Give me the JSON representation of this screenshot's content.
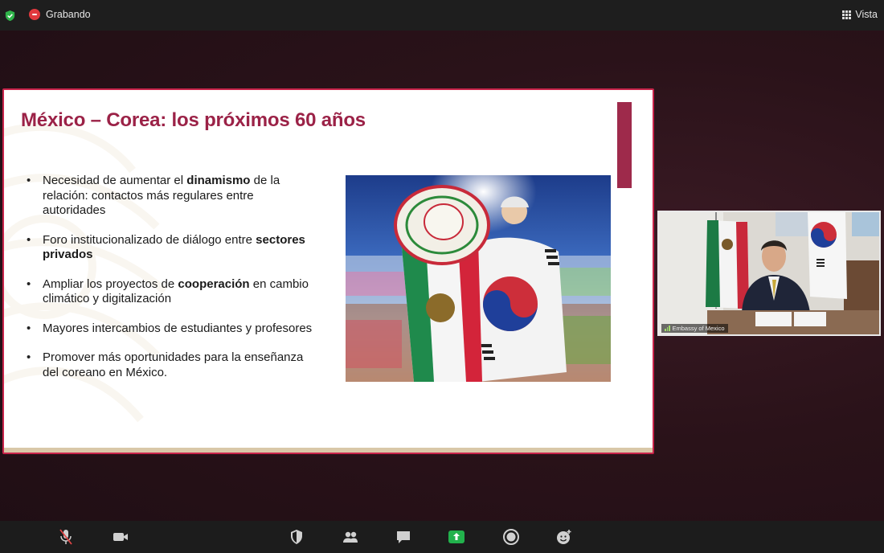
{
  "topbar": {
    "recording_label": "Grabando",
    "view_label": "Vista"
  },
  "slide": {
    "title": "México – Corea: los próximos 60 años",
    "bullets": [
      {
        "before": "Necesidad de aumentar el ",
        "bold": "dinamismo",
        "after": " de la relación: contactos más regulares entre autoridades"
      },
      {
        "before": "Foro institucionalizado de diálogo entre ",
        "bold": "sectores privados",
        "after": ""
      },
      {
        "before": "Ampliar los proyectos de ",
        "bold": "cooperación",
        "after": " en cambio climático y digitalización"
      },
      {
        "before": "Mayores intercambios de estudiantes y profesores",
        "bold": "",
        "after": ""
      },
      {
        "before": "Promover más oportunidades para la enseñanza del coreano en México.",
        "bold": "",
        "after": ""
      }
    ],
    "photo_description_icon": "flags-mexico-korea-photo"
  },
  "speaker": {
    "name": "Embassy of Mexico"
  },
  "toolbar": {
    "buttons": [
      "microphone-muted-icon",
      "video-camera-icon",
      "security-shield-icon",
      "participants-icon",
      "chat-icon",
      "share-screen-icon",
      "record-icon",
      "reactions-icon"
    ]
  },
  "colors": {
    "accent": "#9b2247",
    "slide_border": "#c8244a",
    "recording": "#e0393e",
    "share_green": "#22b24c"
  }
}
